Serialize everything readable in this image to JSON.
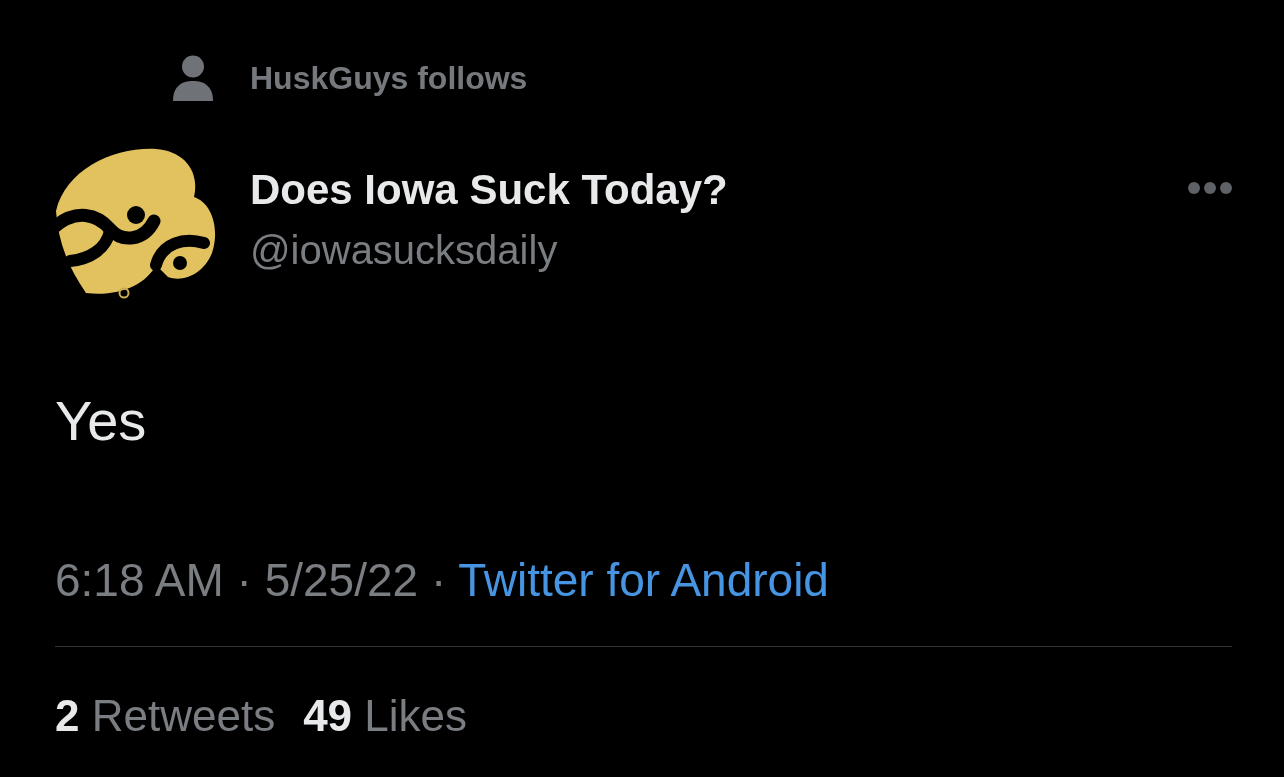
{
  "social_context": {
    "text": "HuskGuys follows"
  },
  "author": {
    "name": "Does Iowa Suck Today?",
    "handle": "@iowasucksdaily"
  },
  "tweet": {
    "text": "Yes"
  },
  "meta": {
    "time": "6:18 AM",
    "separator": "·",
    "date": "5/25/22",
    "source": "Twitter for Android"
  },
  "stats": [
    {
      "count": "2",
      "label": "Retweets"
    },
    {
      "count": "49",
      "label": "Likes"
    }
  ]
}
